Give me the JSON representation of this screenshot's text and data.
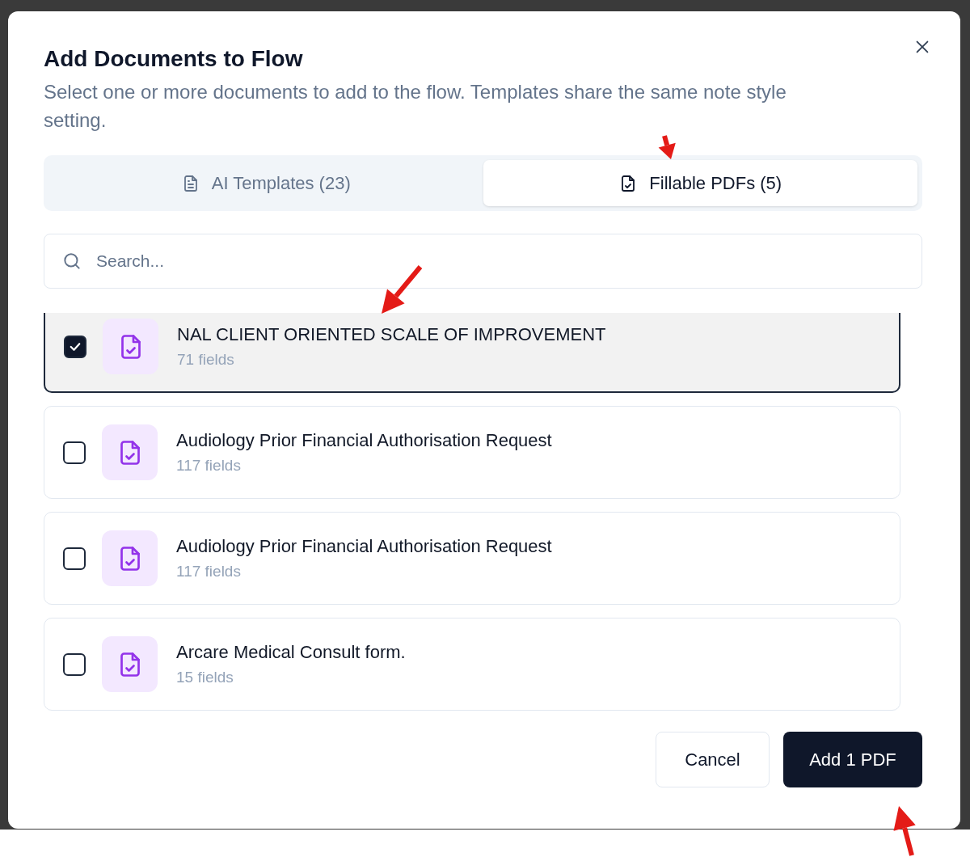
{
  "dialog": {
    "title": "Add Documents to Flow",
    "description": "Select one or more documents to add to the flow. Templates share the same note style setting."
  },
  "tabs": [
    {
      "label": "AI Templates (23)",
      "selected": false,
      "kind": "template"
    },
    {
      "label": "Fillable PDFs (5)",
      "selected": true,
      "kind": "pdf"
    }
  ],
  "search": {
    "placeholder": "Search..."
  },
  "documents": [
    {
      "name": "NAL CLIENT ORIENTED SCALE OF IMPROVEMENT",
      "fields": "71 fields",
      "checked": true
    },
    {
      "name": "Audiology Prior Financial Authorisation Request",
      "fields": "117 fields",
      "checked": false
    },
    {
      "name": "Audiology Prior Financial Authorisation Request",
      "fields": "117 fields",
      "checked": false
    },
    {
      "name": "Arcare Medical Consult form.",
      "fields": "15 fields",
      "checked": false
    }
  ],
  "buttons": [
    {
      "label": "Cancel",
      "kind": "secondary"
    },
    {
      "label": "Add 1 PDF",
      "kind": "primary"
    }
  ]
}
